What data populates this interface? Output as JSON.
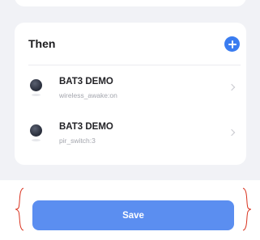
{
  "then_section": {
    "title": "Then",
    "add_icon": "plus-circle-icon",
    "actions": [
      {
        "device_name": "BAT3 DEMO",
        "status": "wireless_awake:on",
        "icon": "device-camera-icon"
      },
      {
        "device_name": "BAT3 DEMO",
        "status": "pir_switch:3",
        "icon": "device-camera-icon"
      }
    ]
  },
  "footer": {
    "save_label": "Save"
  },
  "colors": {
    "page_background": "#f1f2f6",
    "accent": "#3a7cf0",
    "save_button": "#5b8ef0",
    "annotation_bracket": "#d9301c"
  }
}
